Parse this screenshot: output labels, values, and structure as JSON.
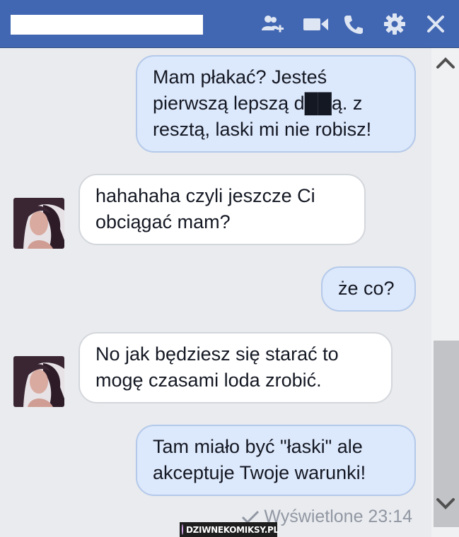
{
  "header": {
    "contact_name": "",
    "icons": [
      "add-friend-icon",
      "video-call-icon",
      "phone-icon",
      "gear-icon",
      "close-icon"
    ]
  },
  "messages": [
    {
      "from": "me",
      "text": "Mam płakać? Jesteś\npierwszą lepszą d██ą. z\nresztą, laski mi nie robisz!"
    },
    {
      "from": "them",
      "text": "hahahaha czyli jeszcze Ci\nobciągać mam?"
    },
    {
      "from": "me",
      "text": "że co?"
    },
    {
      "from": "them",
      "text": "No jak będziesz się starać to\nmogę czasami loda zrobić."
    },
    {
      "from": "me",
      "text": "Tam miało być \"łaski\" ale\nakceptuje Twoje warunki!"
    }
  ],
  "status": {
    "seen_label": "Wyświetlone 23:14"
  },
  "watermark": {
    "text": "DZIWNEKOMIKSY.PL"
  },
  "colors": {
    "header_bg": "#4267b2",
    "outgoing_bubble": "#dce8fb",
    "incoming_bubble": "#ffffff",
    "chat_bg": "#e9ebee"
  }
}
